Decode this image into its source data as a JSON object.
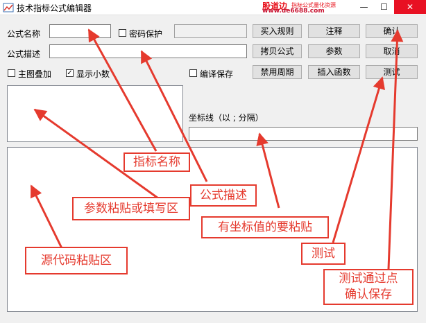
{
  "window": {
    "title": "技术指标公式编辑器",
    "controls": {
      "minimize": "—",
      "maximize": "☐",
      "close": "✕"
    }
  },
  "watermark": {
    "logo": "股道边",
    "slogan": "指标公式量化资源",
    "url": "www.de6688.com"
  },
  "form": {
    "formula_name_label": "公式名称",
    "formula_name_value": "",
    "password_label": "密码保护",
    "password_checked": false,
    "formula_desc_label": "公式描述",
    "formula_desc_value": "",
    "main_overlay_label": "主图叠加",
    "main_overlay_checked": false,
    "show_decimal_label": "显示小数",
    "show_decimal_checked": true,
    "compile_save_label": "编译保存",
    "compile_save_checked": false,
    "axis_line_label": "坐标线（以 ; 分隔）",
    "axis_line_value": ""
  },
  "buttons": {
    "buy_rule": "买入规则",
    "annotate": "注释",
    "confirm": "确认",
    "copy_formula": "拷贝公式",
    "params": "参数",
    "cancel": "取消",
    "disable_period": "禁用周期",
    "insert_function": "插入函数",
    "test": "测试"
  },
  "annotations": {
    "indicator_name": "指标名称",
    "formula_desc": "公式描述",
    "params_area": "参数粘贴或填写区",
    "axis_values": "有坐标值的要粘贴",
    "source_area": "源代码粘贴区",
    "test": "测试",
    "confirm_save_line1": "测试通过点",
    "confirm_save_line2": "确认保存"
  },
  "colors": {
    "annotation_red": "#e53a2e",
    "close_button_red": "#e81123",
    "watermark_red": "#e8101a"
  }
}
